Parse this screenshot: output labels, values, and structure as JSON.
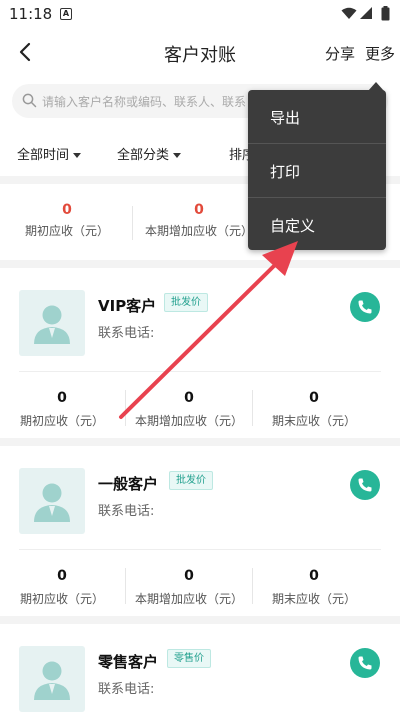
{
  "status": {
    "time": "11:18"
  },
  "nav": {
    "title": "客户对账",
    "share": "分享",
    "more": "更多"
  },
  "search": {
    "placeholder": "请输入客户名称或编码、联系人、联系"
  },
  "filters": [
    {
      "label": "全部时间"
    },
    {
      "label": "全部分类"
    },
    {
      "label": "排序"
    }
  ],
  "summary": [
    {
      "value": "0",
      "label": "期初应收（元）"
    },
    {
      "value": "0",
      "label": "本期增加应收（元）"
    }
  ],
  "menu": {
    "items": [
      "导出",
      "打印",
      "自定义"
    ]
  },
  "phone_label": "联系电话:",
  "stat_labels": [
    "期初应收（元）",
    "本期增加应收（元）",
    "期末应收（元）"
  ],
  "customers": [
    {
      "name": "VIP客户",
      "price_tag": "批发价",
      "stats": [
        "0",
        "0",
        "0"
      ]
    },
    {
      "name": "一般客户",
      "price_tag": "批发价",
      "stats": [
        "0",
        "0",
        "0"
      ]
    },
    {
      "name": "零售客户",
      "price_tag": "零售价",
      "stats": []
    }
  ],
  "colors": {
    "accent": "#27b698",
    "negative": "#e24a3b",
    "arrow": "#e8424f",
    "menu_bg": "#3c3c3c"
  }
}
